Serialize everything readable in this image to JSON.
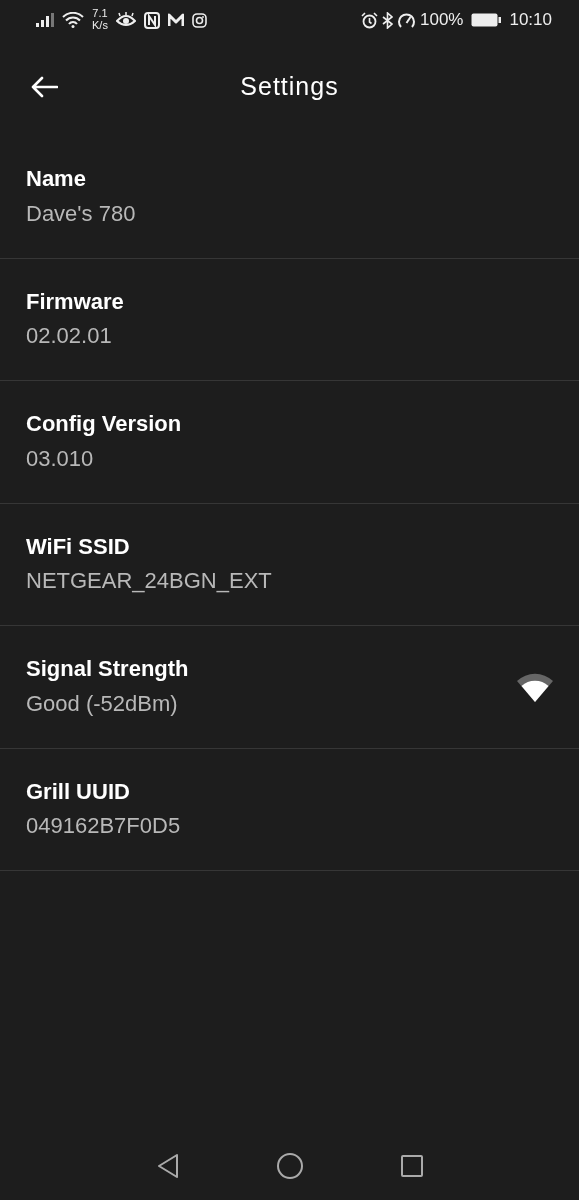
{
  "status_bar": {
    "speed_value": "7.1",
    "speed_unit": "K/s",
    "battery": "100%",
    "time": "10:10"
  },
  "title": "Settings",
  "items": [
    {
      "label": "Name",
      "value": "Dave's 780",
      "kind": "text"
    },
    {
      "label": "Firmware",
      "value": "02.02.01",
      "kind": "text"
    },
    {
      "label": "Config Version",
      "value": "03.010",
      "kind": "text"
    },
    {
      "label": "WiFi SSID",
      "value": "NETGEAR_24BGN_EXT",
      "kind": "text"
    },
    {
      "label": "Signal Strength",
      "value": "Good (-52dBm)",
      "kind": "signal"
    },
    {
      "label": "Grill UUID",
      "value": "049162B7F0D5",
      "kind": "text"
    }
  ]
}
